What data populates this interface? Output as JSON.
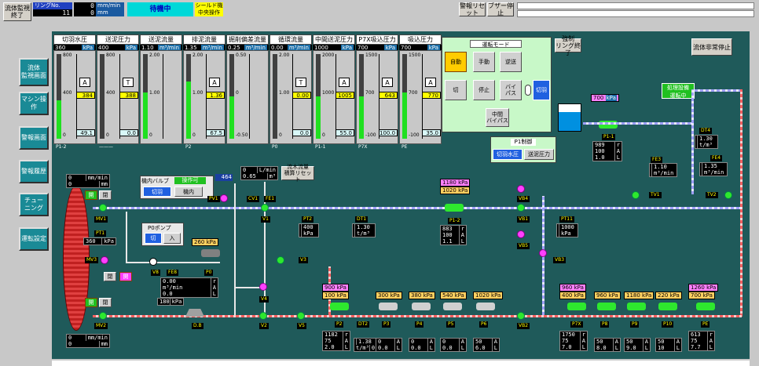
{
  "topbar": {
    "end_button": "流体監視\n終了",
    "ring_no_label": "リングNo.",
    "ring_no_value": "11",
    "speed_value": "0",
    "speed_unit": "mm/min",
    "dist_value": "0",
    "dist_unit": "mm",
    "status": "待機中",
    "shield_op": "シールド機\n中央操作",
    "alarm_reset": "警報リセット",
    "buzzer_stop": "ブザー停止"
  },
  "nav": [
    {
      "label": "流体\n監視画面"
    },
    {
      "label": "マシン操作"
    },
    {
      "label": "警報画面"
    },
    {
      "label": "警報履歴"
    },
    {
      "label": "チュー\nニング"
    },
    {
      "label": "運転設定"
    }
  ],
  "gauges": [
    {
      "title": "切羽水圧",
      "value": "360",
      "unit": "kPa",
      "top": "800",
      "mid": "400",
      "bot": "0",
      "mode": "A",
      "set": "384",
      "read": "49.1",
      "level": 0.45,
      "label": "P1-2"
    },
    {
      "title": "送泥圧力",
      "value": "400",
      "unit": "kPa",
      "top": "800",
      "mid": "400",
      "bot": "0",
      "mode": "T",
      "set": "388",
      "read": "0.0",
      "level": 0.0,
      "label": "———"
    },
    {
      "title": "送泥流量",
      "value": "1.10",
      "unit": "m³/min",
      "top": "2.00",
      "mid": "1.00",
      "bot": "0",
      "mode": "",
      "set": "",
      "read": "",
      "level": 0.55,
      "label": ""
    },
    {
      "title": "排泥流量",
      "value": "1.35",
      "unit": "m³/min",
      "top": "2.00",
      "mid": "1.00",
      "bot": "0",
      "mode": "A",
      "set": "1.36",
      "read": "67.5",
      "level": 0.68,
      "label": "P2"
    },
    {
      "title": "掘削偏差流量",
      "value": "0.25",
      "unit": "m³/min",
      "top": "0.50",
      "mid": "0",
      "bot": "-0.50",
      "mode": "",
      "set": "",
      "read": "",
      "level": 0.5,
      "label": ""
    },
    {
      "title": "循環流量",
      "value": "0.00",
      "unit": "m³/min",
      "top": "2.00",
      "mid": "1.00",
      "bot": "0",
      "mode": "T",
      "set": "0.00",
      "read": "0.0",
      "level": 0.0,
      "label": "P0"
    },
    {
      "title": "中間送泥圧力",
      "value": "1000",
      "unit": "kPa",
      "top": "2000",
      "mid": "1000",
      "bot": "0",
      "mode": "A",
      "set": "1005",
      "read": "55.0",
      "level": 0.5,
      "label": "P1-1"
    },
    {
      "title": "P7X吸込圧力",
      "value": "700",
      "unit": "kPa",
      "top": "1500",
      "mid": "700",
      "bot": "-100",
      "mode": "A",
      "set": "643",
      "read": "100.0",
      "level": 0.5,
      "label": "P7X"
    },
    {
      "title": "吸込圧力",
      "value": "700",
      "unit": "kPa",
      "top": "1500",
      "mid": "700",
      "bot": "-100",
      "mode": "A",
      "set": "770",
      "read": "35.0",
      "level": 0.55,
      "label": "PE"
    }
  ],
  "run_mode": {
    "title": "運転モード",
    "auto": "自動",
    "manual": "手動",
    "reverse": "逆送",
    "off": "切",
    "stop": "停止",
    "bypass": "バイ\nパス",
    "face": "切羽",
    "mid_bypass": "中間\nバイパス"
  },
  "p1_control": {
    "title": "P1制御",
    "face_pressure": "切羽水圧",
    "feed_pressure": "送泥圧力"
  },
  "forced_ring_end": "強制\nリング終了",
  "fluid_emergency": "流体非常停止",
  "treatment": "処理設備\n運転中",
  "tank_pressure": {
    "value": "700",
    "unit": "kPa"
  },
  "p1_1": {
    "label": "P1-1",
    "r": "989",
    "r_unit": "r",
    "a": "100",
    "a_unit": "A",
    "l": "1.0",
    "l_unit": "L"
  },
  "dt4": {
    "label": "DT4",
    "value": "1.30",
    "unit": "t/m³"
  },
  "fe3": {
    "label": "FE3",
    "value": "1.10",
    "unit": "m³/min"
  },
  "fe4": {
    "label": "FE4",
    "value": "1.35",
    "unit": "m³/min"
  },
  "tv1": "TV1",
  "tv2": "TV2",
  "machine": {
    "speed_value": "0",
    "speed_unit": "mm/min",
    "dist_value": "0",
    "dist_unit": "mm",
    "speed2_value": "0",
    "dist2_value": "0",
    "open": "開",
    "close": "閉",
    "mv1": "MV1",
    "mv2": "MV2",
    "mv3": "MV3",
    "pt1": "PT1",
    "pt1_value": "360",
    "pt1_unit": "kPa"
  },
  "inner_valve": {
    "title": "機内バルブ",
    "status": "操作可",
    "face": "切羽",
    "inner": "機内",
    "value": "464",
    "pv1": "PV1"
  },
  "p0_pump": {
    "title": "P0ポンプ",
    "off": "切",
    "on": "入"
  },
  "flow_reset": {
    "value1": "0",
    "unit1": "L/min",
    "value2": "0.65",
    "unit2": "m³",
    "label": "流木流量\n積算リセット"
  },
  "cv1": "CV1",
  "fe1": "FE1",
  "v_labels": {
    "v1": "V1",
    "v2": "V2",
    "v3": "V3",
    "v4": "V4",
    "v5": "V5",
    "v6": "V6",
    "v8": "V8"
  },
  "pt2": {
    "label": "PT2",
    "value": "400",
    "unit": "kPa"
  },
  "dt1": {
    "label": "DT1",
    "value": "1.30",
    "unit": "t/m³"
  },
  "p1_2": {
    "label": "P1-2",
    "p1": "1180",
    "p2": "1020",
    "unit": "kPa",
    "r": "883",
    "a": "100",
    "l": "1.1"
  },
  "vb": {
    "vb1": "VB1",
    "vb2": "VB2",
    "vb3": "VB3",
    "vb4": "VB4",
    "vb5": "VB5"
  },
  "pt11": {
    "label": "PT11",
    "value": "1000",
    "unit": "kPa"
  },
  "p0": {
    "label": "P0",
    "fe8": "FE8",
    "v8": "V8",
    "pressure": "260",
    "unit": "kPa",
    "v1": "0.00",
    "v2": "0",
    "v3": "0.0",
    "u1": "r",
    "u2": "A",
    "u3": "L",
    "u_flow": "m³/min",
    "low_pressure": "180",
    "db": "D.B"
  },
  "pump_p2": {
    "label": "P2",
    "p1": "900",
    "p2": "100",
    "unit": "kPa",
    "r": "1182",
    "a": "75",
    "l": "2.0"
  },
  "dt2": {
    "label": "DT2",
    "value": "1.38",
    "unit": "t/m³",
    "l": "0.0"
  },
  "pumps_mid": [
    {
      "label": "P3",
      "pressure": "300",
      "a": "0",
      "l": "0.0"
    },
    {
      "label": "P4",
      "pressure": "380",
      "a": "0",
      "l": "0.0"
    },
    {
      "label": "P5",
      "pressure": "540",
      "a": "0",
      "l": "0.0"
    },
    {
      "label": "P6",
      "pressure": "1020",
      "a": "50",
      "l": "6.0"
    }
  ],
  "p7x": {
    "label": "P7X",
    "p1": "960",
    "p2": "400",
    "unit": "kPa",
    "r": "1750",
    "a": "75",
    "l": "7.0"
  },
  "pumps_right": [
    {
      "label": "P8",
      "pressure": "960",
      "a": "50",
      "l": "8.0"
    },
    {
      "label": "P9",
      "pressure": "1180",
      "a": "50",
      "l": "9.0"
    },
    {
      "label": "P10",
      "pressure": "220",
      "a": "50",
      "l": "10"
    }
  ],
  "pe": {
    "label": "PE",
    "p1": "1260",
    "p2": "700",
    "unit": "kPa",
    "r": "613",
    "a": "75",
    "l": "7.7"
  },
  "colors": {
    "bg": "#1f5a5a",
    "accent": "#ffff00",
    "valve_open": "#2ee82e",
    "valve_mid": "#ff40ff"
  }
}
